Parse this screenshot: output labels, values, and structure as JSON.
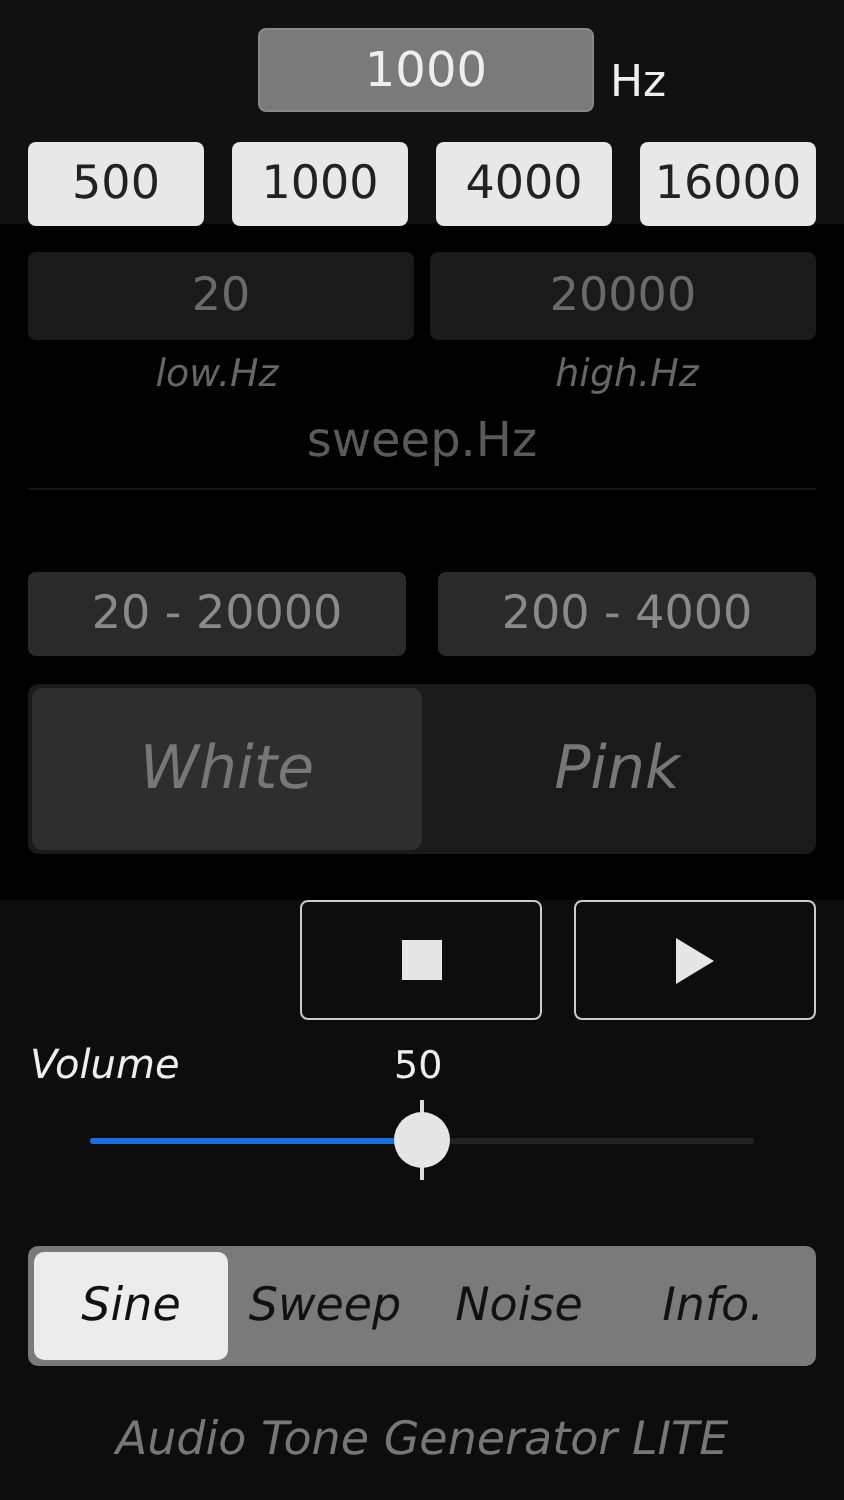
{
  "frequency": {
    "value": "1000",
    "unit": "Hz"
  },
  "presets": [
    "500",
    "1000",
    "4000",
    "16000"
  ],
  "sweep": {
    "disabled": true,
    "low": {
      "value": "20",
      "label": "low.Hz"
    },
    "high": {
      "value": "20000",
      "label": "high.Hz"
    },
    "title": "sweep.Hz",
    "ranges": [
      "20 - 20000",
      "200 - 4000"
    ]
  },
  "noise": {
    "disabled": true,
    "options": [
      {
        "label": "White",
        "selected": true
      },
      {
        "label": "Pink",
        "selected": false
      }
    ]
  },
  "transport": [
    {
      "kind": "stop"
    },
    {
      "kind": "play"
    }
  ],
  "volume": {
    "label": "Volume",
    "reading": "50",
    "level": 0.5
  },
  "tabs": [
    {
      "label": "Sine",
      "selected": true
    },
    {
      "label": "Sweep",
      "selected": false
    },
    {
      "label": "Noise",
      "selected": false
    },
    {
      "label": "Info.",
      "selected": false
    }
  ],
  "footer": "Audio Tone Generator LITE"
}
